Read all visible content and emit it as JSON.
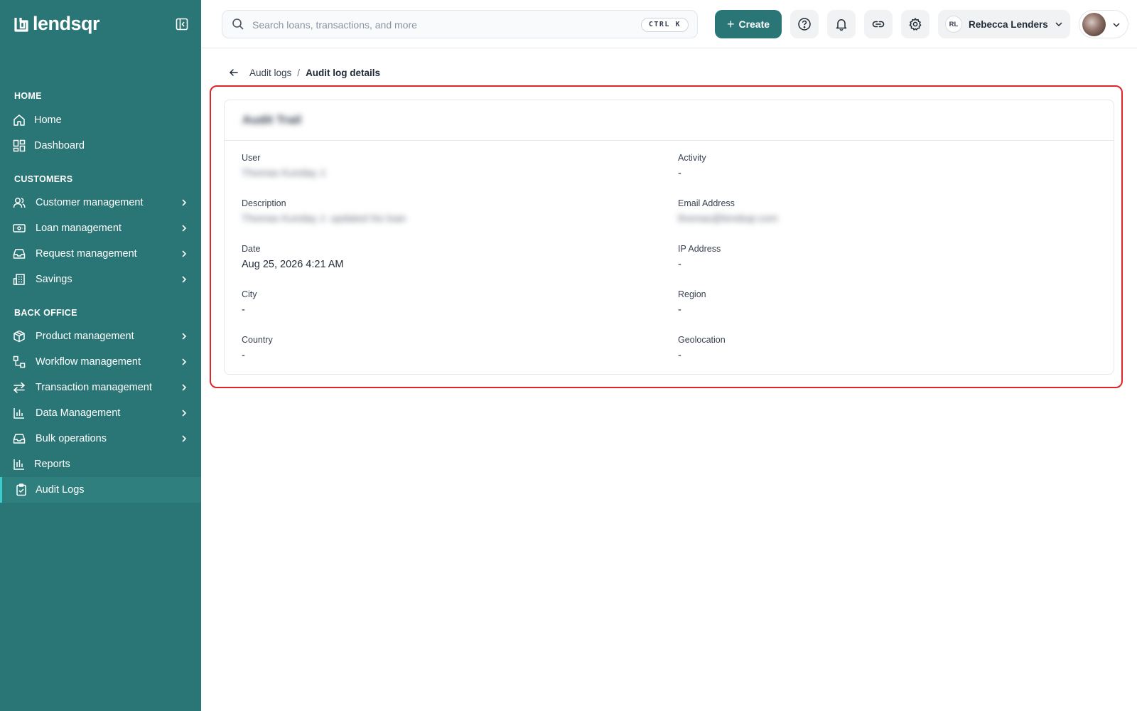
{
  "app": {
    "logo_text": "lendsqr"
  },
  "sidebar": {
    "sections": {
      "home": "HOME",
      "customers": "CUSTOMERS",
      "back_office": "BACK OFFICE"
    },
    "items": [
      {
        "label": "Home",
        "icon": "home-icon"
      },
      {
        "label": "Dashboard",
        "icon": "dashboard-icon"
      },
      {
        "label": "Customer management",
        "icon": "users-icon"
      },
      {
        "label": "Loan management",
        "icon": "loan-icon"
      },
      {
        "label": "Request management",
        "icon": "inbox-icon"
      },
      {
        "label": "Savings",
        "icon": "savings-icon"
      },
      {
        "label": "Product management",
        "icon": "box-icon"
      },
      {
        "label": "Workflow management",
        "icon": "workflow-icon"
      },
      {
        "label": "Transaction management",
        "icon": "arrows-icon"
      },
      {
        "label": "Data Management",
        "icon": "bar-chart-icon"
      },
      {
        "label": "Bulk operations",
        "icon": "inbox-icon"
      },
      {
        "label": "Reports",
        "icon": "reports-icon"
      },
      {
        "label": "Audit Logs",
        "icon": "clipboard-icon",
        "active": true
      }
    ]
  },
  "header": {
    "search_placeholder": "Search loans, transactions, and more",
    "shortcut": "CTRL K",
    "create_label": "Create",
    "account_initials": "RL",
    "account_name": "Rebecca Lenders"
  },
  "breadcrumb": {
    "parent": "Audit logs",
    "separator": "/",
    "current": "Audit log details"
  },
  "card": {
    "title": "Audit Trail",
    "fields": [
      {
        "label": "User",
        "value": "Thomas Kunday J.",
        "blurred": true
      },
      {
        "label": "Activity",
        "value": "-"
      },
      {
        "label": "Description",
        "value": "Thomas Kunday J. updated his loan",
        "blurred": true
      },
      {
        "label": "Email Address",
        "value": "thomas@lendsqr.com",
        "blurred": true
      },
      {
        "label": "Date",
        "value": "Aug 25, 2026 4:21 AM"
      },
      {
        "label": "IP Address",
        "value": "-"
      },
      {
        "label": "City",
        "value": "-"
      },
      {
        "label": "Region",
        "value": "-"
      },
      {
        "label": "Country",
        "value": "-"
      },
      {
        "label": "Geolocation",
        "value": "-"
      }
    ]
  },
  "colors": {
    "sidebar_bg": "#2a7575",
    "active_accent": "#39cdcc",
    "highlight_border": "#e0242a"
  }
}
